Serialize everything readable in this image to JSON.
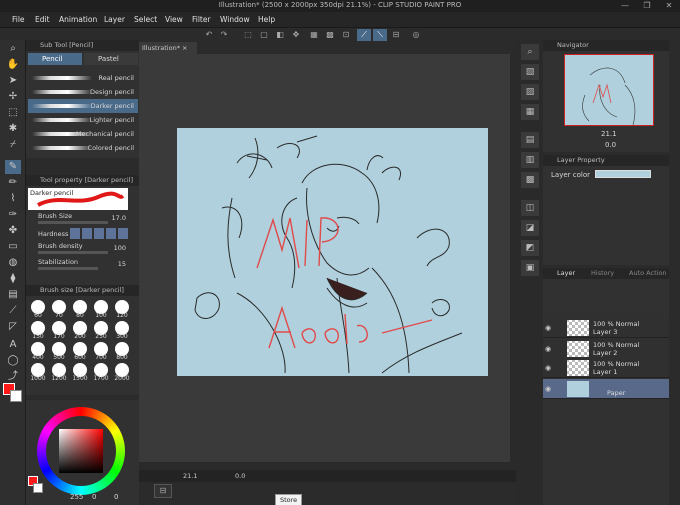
{
  "window": {
    "title": "Illustration* (2500 x 2000px 350dpi 21.1%) - CLIP STUDIO PAINT PRO",
    "minimize": "—",
    "maximize": "❐",
    "close": "✕"
  },
  "menu": [
    "File",
    "Edit",
    "Animation",
    "Layer",
    "Select",
    "View",
    "Filter",
    "Window",
    "Help"
  ],
  "subtool": {
    "header": "Sub Tool [Pencil]",
    "tabs": [
      "Pencil",
      "Pastel"
    ],
    "brushes": [
      "Real pencil",
      "Design pencil",
      "Darker pencil",
      "Lighter pencil",
      "Mechanical pencil",
      "Colored pencil"
    ],
    "selected_index": 2
  },
  "toolprop": {
    "header": "Tool property [Darker pencil]",
    "preview_label": "Darker pencil",
    "rows": [
      {
        "label": "Brush Size",
        "value": "17.0"
      },
      {
        "label": "Hardness",
        "value": ""
      },
      {
        "label": "Brush density",
        "value": "100"
      },
      {
        "label": "Stabilization",
        "value": "15"
      }
    ]
  },
  "brushsize": {
    "header": "Brush size [Darker pencil]",
    "sizes": [
      "60",
      "70",
      "80",
      "100",
      "120",
      "150",
      "170",
      "200",
      "250",
      "300",
      "400",
      "500",
      "600",
      "700",
      "800",
      "1000",
      "1200",
      "1500",
      "1700",
      "2000"
    ]
  },
  "colorwheel": {
    "r": "255",
    "g": "0",
    "b": "0",
    "main_color": "#ff1a1a",
    "sub_color": "#ffffff"
  },
  "document": {
    "tab": "Illustration*",
    "zoom": "21.1",
    "rotation": "0.0"
  },
  "artwork": {
    "watermark_1": "WIP",
    "watermark_2": "Aooo!b-",
    "bg_color": "#afd0dc",
    "ink_color": "#e24a4a"
  },
  "navigator": {
    "header": "Navigator",
    "zoom": "21.1",
    "rotation": "0.0"
  },
  "layerprop": {
    "header": "Layer Property",
    "color_label": "Layer color",
    "color": "#afd0dc"
  },
  "layers": {
    "tabs": [
      "Layer",
      "History",
      "Auto Action"
    ],
    "items": [
      {
        "opacity": "100 % Normal",
        "name": "Layer 3"
      },
      {
        "opacity": "100 % Normal",
        "name": "Layer 2"
      },
      {
        "opacity": "100 % Normal",
        "name": "Layer 1"
      },
      {
        "opacity": "",
        "name": "Paper"
      }
    ]
  },
  "tooltip": "Store"
}
